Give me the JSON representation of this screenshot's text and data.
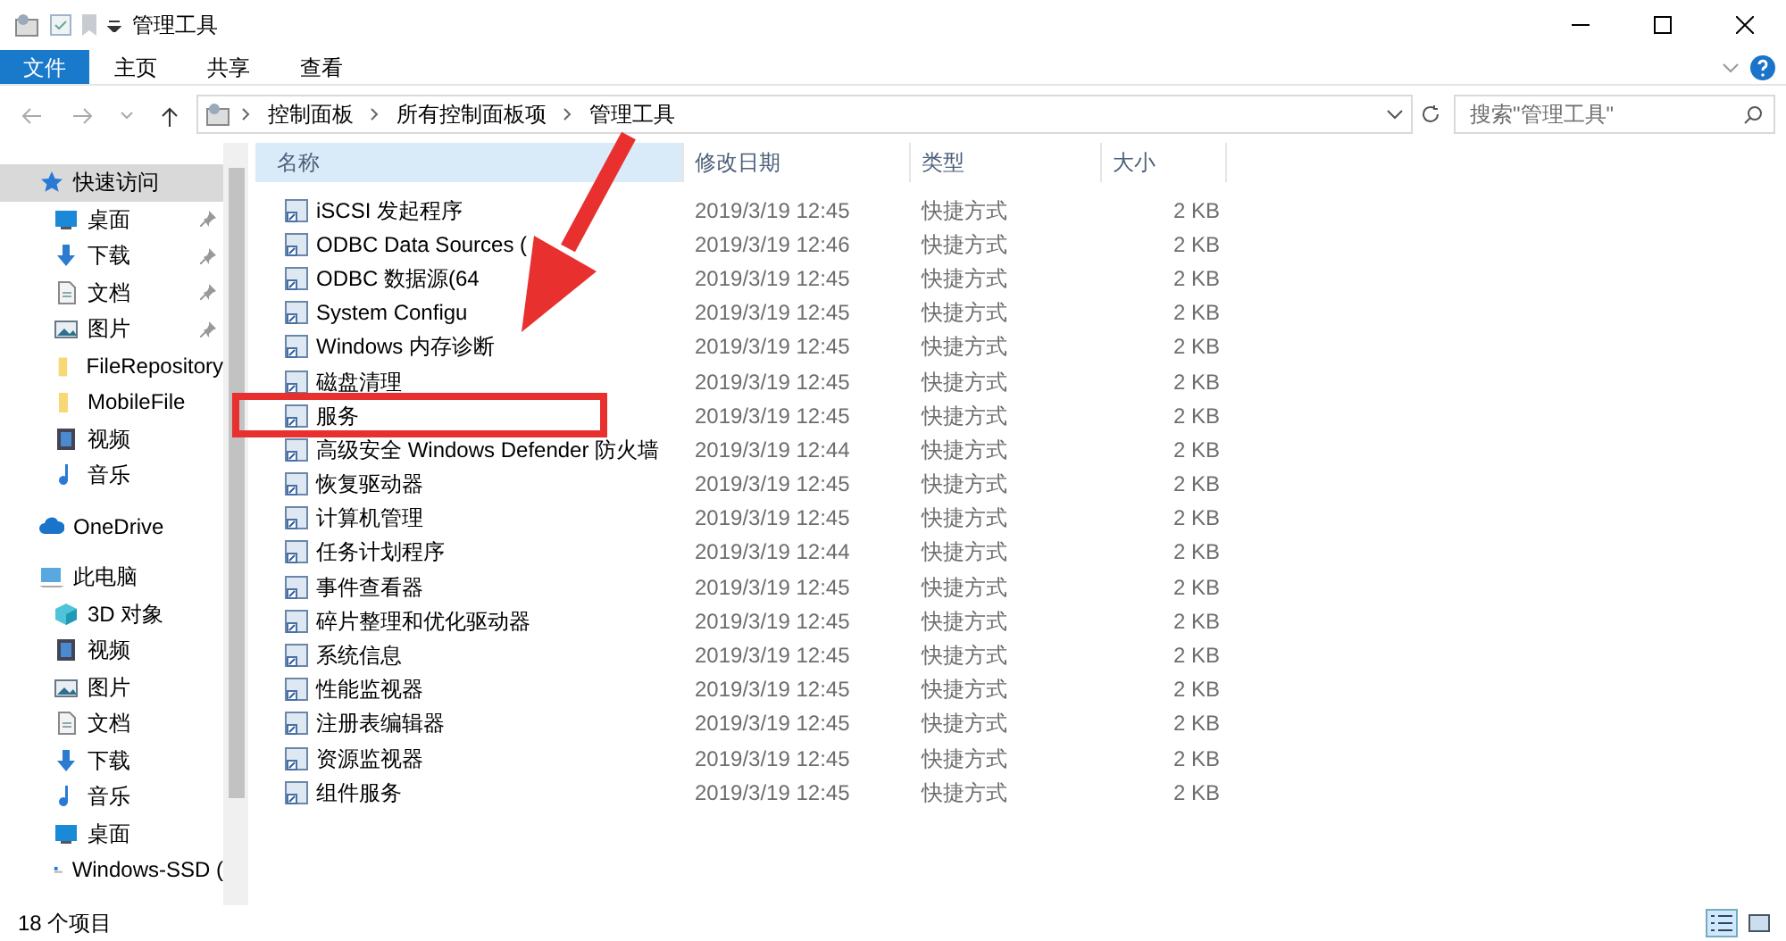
{
  "window": {
    "title": "管理工具"
  },
  "ribbon": {
    "tabs": [
      {
        "label": "文件",
        "selected": true
      },
      {
        "label": "主页",
        "selected": false
      },
      {
        "label": "共享",
        "selected": false
      },
      {
        "label": "查看",
        "selected": false
      }
    ]
  },
  "address": {
    "crumbs": [
      "控制面板",
      "所有控制面板项",
      "管理工具"
    ]
  },
  "search": {
    "placeholder": "搜索\"管理工具\""
  },
  "sidebar": {
    "items": [
      {
        "label": "快速访问",
        "kind": "star",
        "selected": true,
        "children": [
          {
            "label": "桌面",
            "kind": "desktop",
            "pinned": true
          },
          {
            "label": "下载",
            "kind": "download",
            "pinned": true
          },
          {
            "label": "文档",
            "kind": "document",
            "pinned": true
          },
          {
            "label": "图片",
            "kind": "pictures",
            "pinned": true
          },
          {
            "label": "FileRepository",
            "kind": "folder",
            "pinned": false
          },
          {
            "label": "MobileFile",
            "kind": "folder",
            "pinned": false
          },
          {
            "label": "视频",
            "kind": "video",
            "pinned": false
          },
          {
            "label": "音乐",
            "kind": "music",
            "pinned": false
          }
        ]
      },
      {
        "label": "OneDrive",
        "kind": "cloud",
        "selected": false
      },
      {
        "label": "此电脑",
        "kind": "computer",
        "selected": false,
        "children": [
          {
            "label": "3D 对象",
            "kind": "cube",
            "pinned": false
          },
          {
            "label": "视频",
            "kind": "video",
            "pinned": false
          },
          {
            "label": "图片",
            "kind": "pictures",
            "pinned": false
          },
          {
            "label": "文档",
            "kind": "document",
            "pinned": false
          },
          {
            "label": "下载",
            "kind": "download",
            "pinned": false
          },
          {
            "label": "音乐",
            "kind": "music",
            "pinned": false
          },
          {
            "label": "桌面",
            "kind": "desktop",
            "pinned": false
          },
          {
            "label": "Windows-SSD (",
            "kind": "drive",
            "pinned": false
          }
        ]
      }
    ]
  },
  "table": {
    "columns": [
      "名称",
      "修改日期",
      "类型",
      "大小"
    ],
    "rows": [
      {
        "name": "iSCSI 发起程序",
        "modified": "2019/3/19 12:45",
        "type": "快捷方式",
        "size": "2 KB",
        "highlighted": false
      },
      {
        "name": "ODBC Data Sources (",
        "modified": "2019/3/19 12:46",
        "type": "快捷方式",
        "size": "2 KB",
        "highlighted": false
      },
      {
        "name": "ODBC 数据源(64",
        "modified": "2019/3/19 12:45",
        "type": "快捷方式",
        "size": "2 KB",
        "highlighted": false
      },
      {
        "name": "System Configu",
        "modified": "2019/3/19 12:45",
        "type": "快捷方式",
        "size": "2 KB",
        "highlighted": false
      },
      {
        "name": "Windows 内存诊断",
        "modified": "2019/3/19 12:45",
        "type": "快捷方式",
        "size": "2 KB",
        "highlighted": false
      },
      {
        "name": "磁盘清理",
        "modified": "2019/3/19 12:45",
        "type": "快捷方式",
        "size": "2 KB",
        "highlighted": false
      },
      {
        "name": "服务",
        "modified": "2019/3/19 12:45",
        "type": "快捷方式",
        "size": "2 KB",
        "highlighted": true
      },
      {
        "name": "高级安全 Windows Defender 防火墙",
        "modified": "2019/3/19 12:44",
        "type": "快捷方式",
        "size": "2 KB",
        "highlighted": false
      },
      {
        "name": "恢复驱动器",
        "modified": "2019/3/19 12:45",
        "type": "快捷方式",
        "size": "2 KB",
        "highlighted": false
      },
      {
        "name": "计算机管理",
        "modified": "2019/3/19 12:45",
        "type": "快捷方式",
        "size": "2 KB",
        "highlighted": false
      },
      {
        "name": "任务计划程序",
        "modified": "2019/3/19 12:44",
        "type": "快捷方式",
        "size": "2 KB",
        "highlighted": false
      },
      {
        "name": "事件查看器",
        "modified": "2019/3/19 12:45",
        "type": "快捷方式",
        "size": "2 KB",
        "highlighted": false
      },
      {
        "name": "碎片整理和优化驱动器",
        "modified": "2019/3/19 12:45",
        "type": "快捷方式",
        "size": "2 KB",
        "highlighted": false
      },
      {
        "name": "系统信息",
        "modified": "2019/3/19 12:45",
        "type": "快捷方式",
        "size": "2 KB",
        "highlighted": false
      },
      {
        "name": "性能监视器",
        "modified": "2019/3/19 12:45",
        "type": "快捷方式",
        "size": "2 KB",
        "highlighted": false
      },
      {
        "name": "注册表编辑器",
        "modified": "2019/3/19 12:45",
        "type": "快捷方式",
        "size": "2 KB",
        "highlighted": false
      },
      {
        "name": "资源监视器",
        "modified": "2019/3/19 12:45",
        "type": "快捷方式",
        "size": "2 KB",
        "highlighted": false
      },
      {
        "name": "组件服务",
        "modified": "2019/3/19 12:45",
        "type": "快捷方式",
        "size": "2 KB",
        "highlighted": false
      }
    ]
  },
  "annotation_arrow": true,
  "status_bar": {
    "count": "18 个项目"
  }
}
